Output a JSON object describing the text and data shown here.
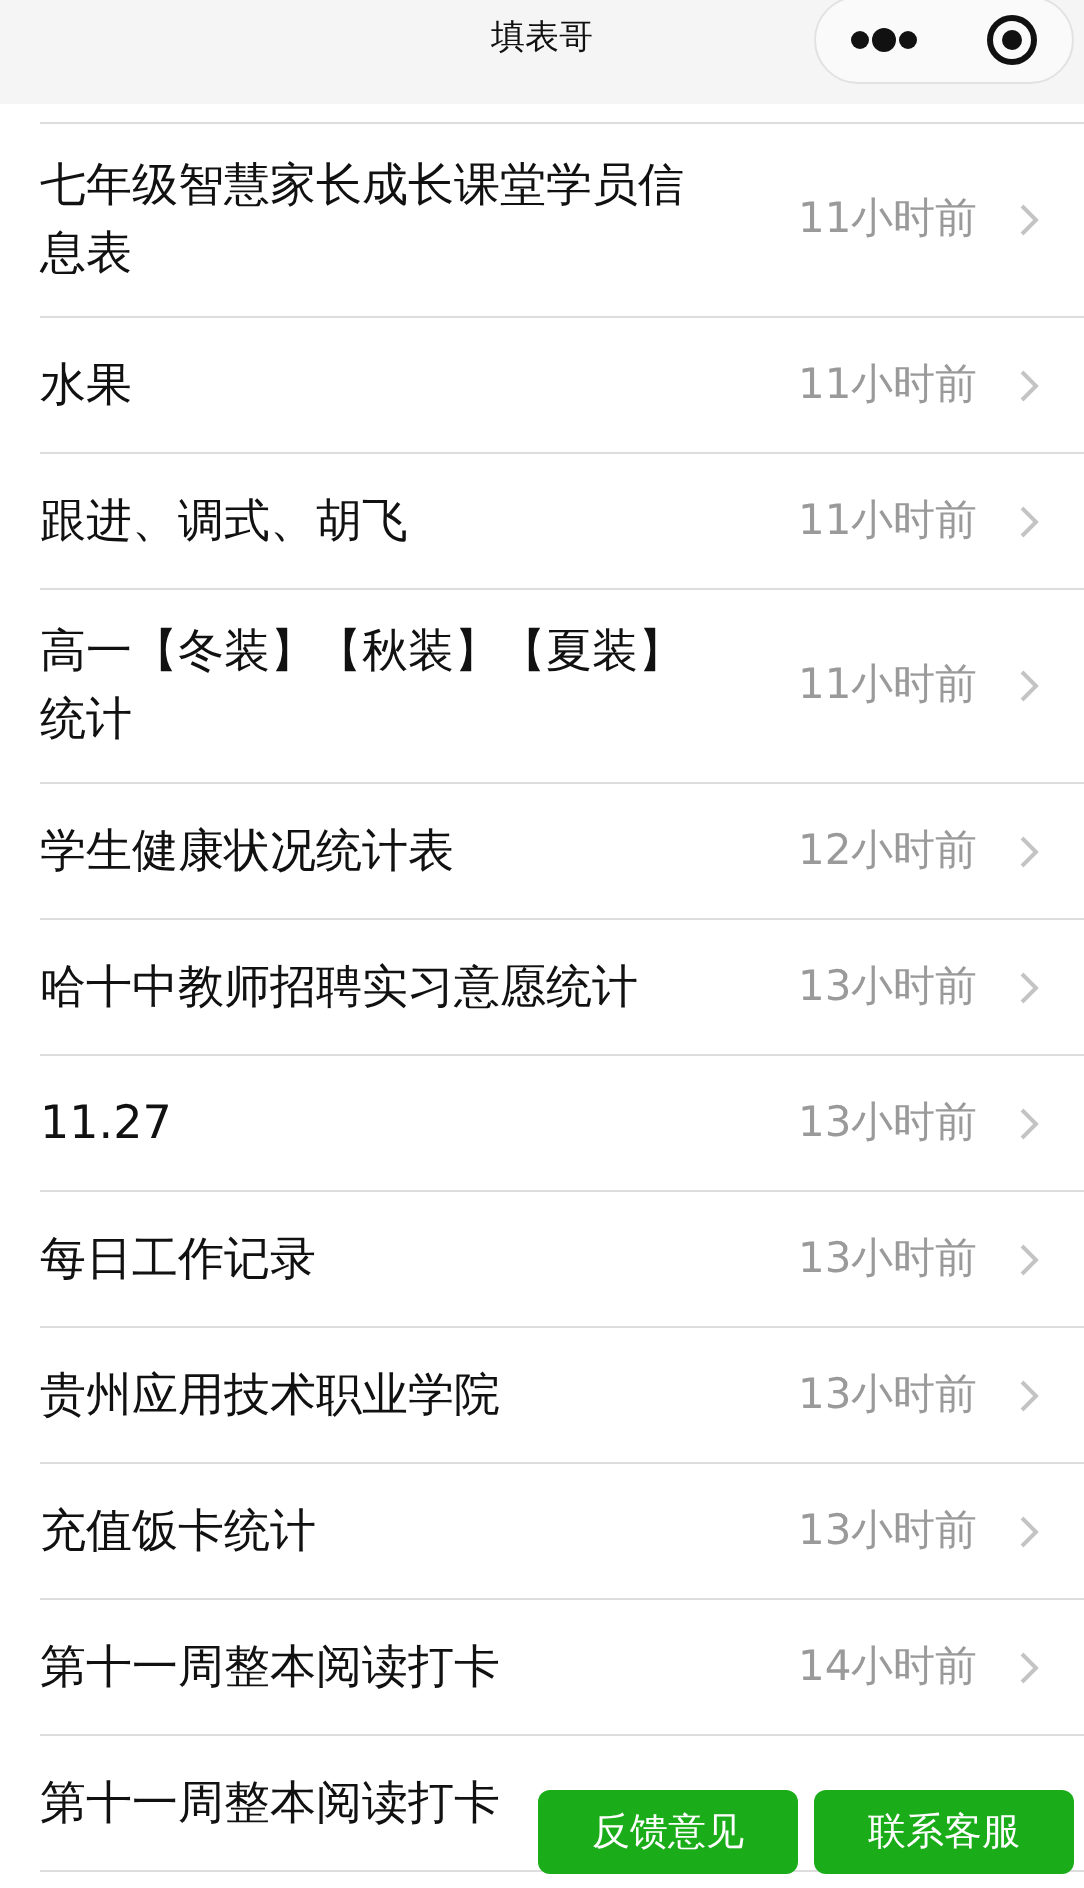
{
  "window": {
    "title": "填表哥"
  },
  "rows": [
    {
      "title": "七年级智慧家长成长课堂学员信息表",
      "time": "11小时前"
    },
    {
      "title": "水果",
      "time": "11小时前"
    },
    {
      "title": "跟进、调式、胡飞",
      "time": "11小时前"
    },
    {
      "title": "高一【冬装】【秋装】【夏装】统计",
      "time": "11小时前"
    },
    {
      "title": "学生健康状况统计表",
      "time": "12小时前"
    },
    {
      "title": "哈十中教师招聘实习意愿统计",
      "time": "13小时前"
    },
    {
      "title": "11.27",
      "time": "13小时前"
    },
    {
      "title": "每日工作记录",
      "time": "13小时前"
    },
    {
      "title": "贵州应用技术职业学院",
      "time": "13小时前"
    },
    {
      "title": "充值饭卡统计",
      "time": "13小时前"
    },
    {
      "title": "第十一周整本阅读打卡",
      "time": "14小时前"
    },
    {
      "title": "第十一周整本阅读打卡"
    }
  ],
  "buttons": [
    "反馈意见",
    "联系客服"
  ]
}
